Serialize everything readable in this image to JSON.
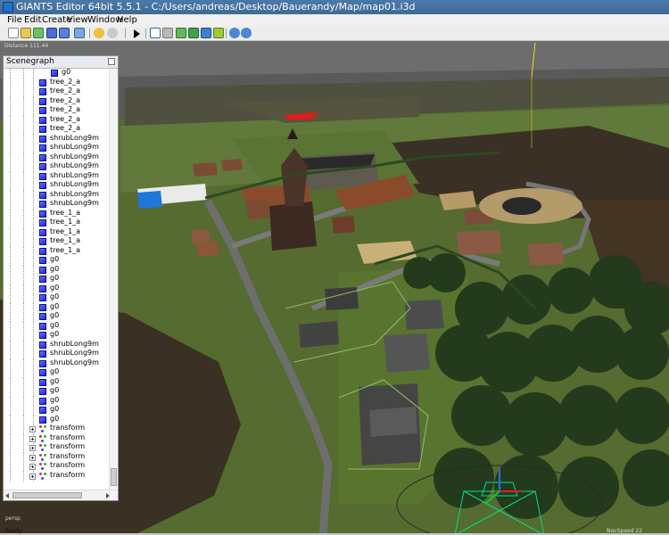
{
  "window": {
    "title": "GIANTS Editor 64bit 5.5.1 - C:/Users/andreas/Desktop/Bauerandy/Map/map01.i3d"
  },
  "menu": [
    "File",
    "Edit",
    "Create",
    "View",
    "Window",
    "Help"
  ],
  "toolbar_icons": [
    "new-file-icon",
    "open-folder-icon",
    "refresh-icon",
    "save-icon",
    "save-as-icon",
    "import-icon",
    "undo-icon",
    "redo-icon",
    "play-icon",
    "select-mode-icon",
    "move-icon",
    "terrain-paint-icon",
    "foliage-paint-icon",
    "texture-paint-icon",
    "camera-icon",
    "camera-settings-icon"
  ],
  "viewport": {
    "distance_label": "Distance 111.44",
    "camera_mode": "persp",
    "nav_speed": "NavSpeed 22",
    "status": "Ready"
  },
  "scenegraph": {
    "title": "Scenegraph",
    "items": [
      {
        "label": "g0",
        "type": "shape",
        "indent": 1
      },
      {
        "label": "tree_2_a",
        "type": "shape",
        "indent": 0
      },
      {
        "label": "tree_2_a",
        "type": "shape",
        "indent": 0
      },
      {
        "label": "tree_2_a",
        "type": "shape",
        "indent": 0
      },
      {
        "label": "tree_2_a",
        "type": "shape",
        "indent": 0
      },
      {
        "label": "tree_2_a",
        "type": "shape",
        "indent": 0
      },
      {
        "label": "tree_2_a",
        "type": "shape",
        "indent": 0
      },
      {
        "label": "shrubLong9m",
        "type": "shape",
        "indent": 0
      },
      {
        "label": "shrubLong9m",
        "type": "shape",
        "indent": 0
      },
      {
        "label": "shrubLong9m",
        "type": "shape",
        "indent": 0
      },
      {
        "label": "shrubLong9m",
        "type": "shape",
        "indent": 0
      },
      {
        "label": "shrubLong9m",
        "type": "shape",
        "indent": 0
      },
      {
        "label": "shrubLong9m",
        "type": "shape",
        "indent": 0
      },
      {
        "label": "shrubLong9m",
        "type": "shape",
        "indent": 0
      },
      {
        "label": "shrubLong9m",
        "type": "shape",
        "indent": 0
      },
      {
        "label": "tree_1_a",
        "type": "shape",
        "indent": 0
      },
      {
        "label": "tree_1_a",
        "type": "shape",
        "indent": 0
      },
      {
        "label": "tree_1_a",
        "type": "shape",
        "indent": 0
      },
      {
        "label": "tree_1_a",
        "type": "shape",
        "indent": 0
      },
      {
        "label": "tree_1_a",
        "type": "shape",
        "indent": 0
      },
      {
        "label": "g0",
        "type": "shape",
        "indent": 0
      },
      {
        "label": "g0",
        "type": "shape",
        "indent": 0
      },
      {
        "label": "g0",
        "type": "shape",
        "indent": 0
      },
      {
        "label": "g0",
        "type": "shape",
        "indent": 0
      },
      {
        "label": "g0",
        "type": "shape",
        "indent": 0
      },
      {
        "label": "g0",
        "type": "shape",
        "indent": 0
      },
      {
        "label": "g0",
        "type": "shape",
        "indent": 0
      },
      {
        "label": "g0",
        "type": "shape",
        "indent": 0
      },
      {
        "label": "g0",
        "type": "shape",
        "indent": 0
      },
      {
        "label": "shrubLong9m",
        "type": "shape",
        "indent": 0
      },
      {
        "label": "shrubLong9m",
        "type": "shape",
        "indent": 0
      },
      {
        "label": "shrubLong9m",
        "type": "shape",
        "indent": 0
      },
      {
        "label": "g0",
        "type": "shape",
        "indent": 0
      },
      {
        "label": "g0",
        "type": "shape",
        "indent": 0
      },
      {
        "label": "g0",
        "type": "shape",
        "indent": 0
      },
      {
        "label": "g0",
        "type": "shape",
        "indent": 0
      },
      {
        "label": "g0",
        "type": "shape",
        "indent": 0
      },
      {
        "label": "g0",
        "type": "shape",
        "indent": 0
      },
      {
        "label": "transform",
        "type": "transform",
        "indent": -1
      },
      {
        "label": "transform",
        "type": "transform",
        "indent": -1
      },
      {
        "label": "transform",
        "type": "transform",
        "indent": -1
      },
      {
        "label": "transform",
        "type": "transform",
        "indent": -1
      },
      {
        "label": "transform",
        "type": "transform",
        "indent": -1
      },
      {
        "label": "transform",
        "type": "transform",
        "indent": -1
      }
    ]
  },
  "colors": {
    "titlebar": "#4474a4",
    "selection_line": "#f0e000",
    "gizmo": "#00e08a",
    "node_icon": "#2a2ee6"
  }
}
